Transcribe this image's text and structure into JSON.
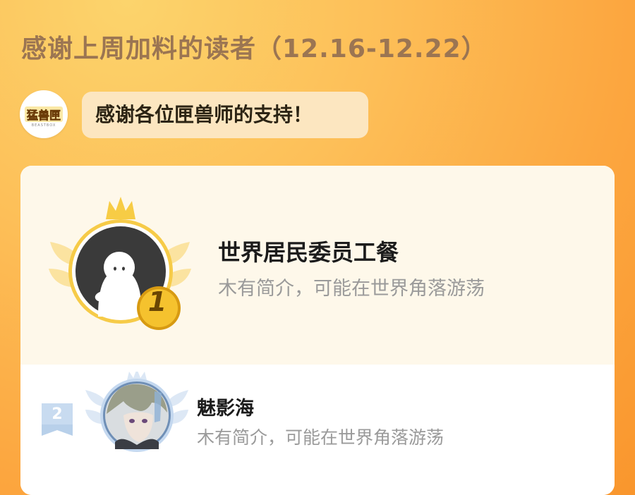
{
  "header": {
    "title": "感谢上周加料的读者（12.16-12.22）"
  },
  "message": {
    "avatar_logo_text": "猛兽匣",
    "avatar_logo_sub": "BEASTBOX",
    "text": "感谢各位匣兽师的支持！"
  },
  "leaderboard": {
    "rows": [
      {
        "rank": "1",
        "name": "世界居民委员工餐",
        "intro": "木有简介，可能在世界角落游荡",
        "medal_color": "#f7c63a"
      },
      {
        "rank": "2",
        "name": "魅影海",
        "intro": "木有简介，可能在世界角落游荡",
        "medal_color": "#b7cfe9"
      }
    ]
  }
}
